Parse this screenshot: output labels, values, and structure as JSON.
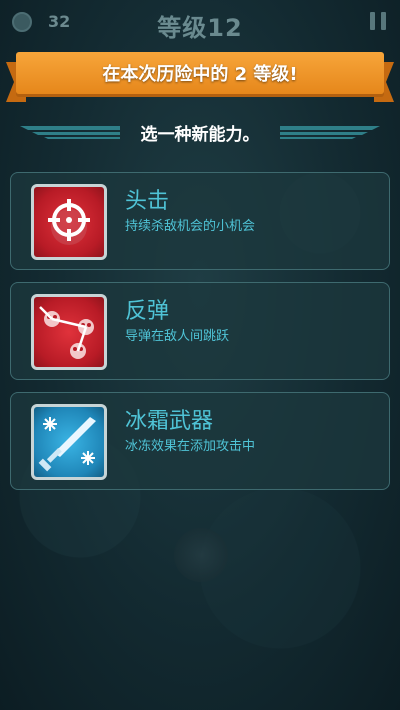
{
  "header": {
    "coins": "32",
    "level_title": "等级12"
  },
  "banner": {
    "text": "在本次历险中的 2 等级!"
  },
  "subtitle": "选一种新能力。",
  "abilities": [
    {
      "name": "头击",
      "description": "持续杀敌机会的小机会",
      "icon": "crosshair-skull-icon",
      "color": "#c8202a"
    },
    {
      "name": "反弹",
      "description": "导弹在敌人间跳跃",
      "icon": "bouncing-skulls-icon",
      "color": "#c8202a"
    },
    {
      "name": "冰霜武器",
      "description": "冰冻效果在添加攻击中",
      "icon": "frost-dagger-icon",
      "color": "#1f86b8"
    }
  ],
  "colors": {
    "accent": "#4fc3d6",
    "banner": "#f29a2e",
    "card_border": "#3e6a6f"
  }
}
